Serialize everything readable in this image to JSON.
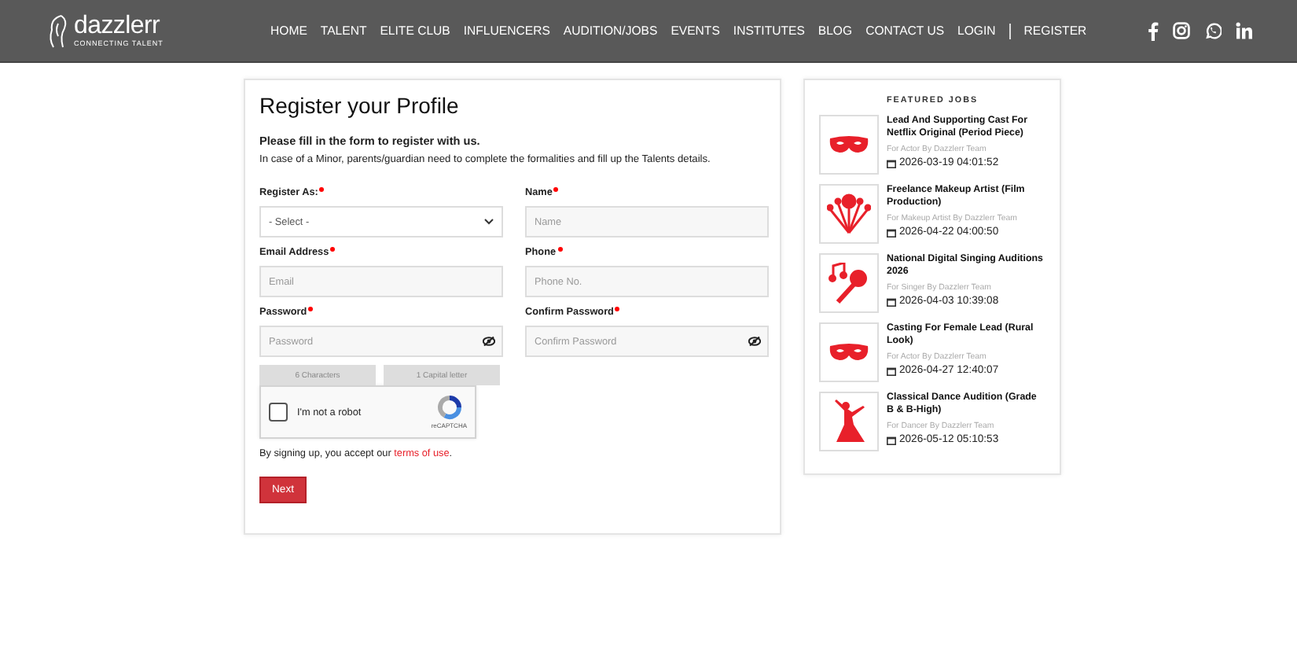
{
  "header": {
    "logo": {
      "name": "dazzlerr",
      "tagline": "CONNECTING TALENT"
    },
    "nav": [
      {
        "label": "HOME"
      },
      {
        "label": "TALENT"
      },
      {
        "label": "ELITE CLUB"
      },
      {
        "label": "INFLUENCERS"
      },
      {
        "label": "AUDITION/JOBS"
      },
      {
        "label": "EVENTS"
      },
      {
        "label": "INSTITUTES"
      },
      {
        "label": "BLOG"
      },
      {
        "label": "CONTACT US"
      },
      {
        "label": "LOGIN"
      },
      {
        "label": "REGISTER"
      }
    ],
    "social": [
      {
        "kind": "facebook"
      },
      {
        "kind": "instagram"
      },
      {
        "kind": "whatsapp"
      },
      {
        "kind": "linkedin"
      }
    ]
  },
  "form": {
    "title": "Register your Profile",
    "subtitle": "Please fill in the form to register with us.",
    "note": "In case of a Minor, parents/guardian need to complete the formalities and fill up the Talents details.",
    "fields": [
      {
        "kind": "select",
        "label": "Register As:",
        "value": "- Select -",
        "required": true
      },
      {
        "kind": "text",
        "label": "Name",
        "placeholder": "Name",
        "required": true
      },
      {
        "kind": "text",
        "label": "Email Address",
        "placeholder": "Email",
        "required": true
      },
      {
        "kind": "text",
        "label": "Phone",
        "placeholder": "Phone No.",
        "required": true
      },
      {
        "kind": "password",
        "label": "Password",
        "placeholder": "Password",
        "required": true
      },
      {
        "kind": "password",
        "label": "Confirm Password",
        "placeholder": "Confirm Password",
        "required": true
      }
    ],
    "password_rules": [
      "6 Characters",
      "1 Capital letter"
    ],
    "captcha": {
      "label": "I'm not a robot",
      "brand": "reCAPTCHA",
      "checked": false
    },
    "terms": {
      "text": "By signing up, you accept our ",
      "link": "terms of use",
      "end": "."
    },
    "next_button": "Next"
  },
  "featured_jobs": {
    "title": "FEATURED JOBS",
    "jobs": [
      {
        "kind": "mask",
        "title": "Lead And Supporting Cast For Netflix Original (Period Piece)",
        "meta": "For Actor By Dazzlerr Team",
        "date": "2026-03-19 04:01:52"
      },
      {
        "kind": "makeup",
        "title": "Freelance Makeup Artist (Film Production)",
        "meta": "For Makeup Artist By Dazzlerr Team",
        "date": "2026-04-22 04:00:50"
      },
      {
        "kind": "singer",
        "title": "National Digital Singing Auditions 2026",
        "meta": "For Singer By Dazzlerr Team",
        "date": "2026-04-03 10:39:08"
      },
      {
        "kind": "mask",
        "title": "Casting For Female Lead (Rural Look)",
        "meta": "For Actor By Dazzlerr Team",
        "date": "2026-04-27 12:40:07"
      },
      {
        "kind": "dancer",
        "title": "Classical Dance Audition (Grade B & B-High)",
        "meta": "For Dancer By Dazzlerr Team",
        "date": "2026-05-12 05:10:53"
      }
    ]
  }
}
